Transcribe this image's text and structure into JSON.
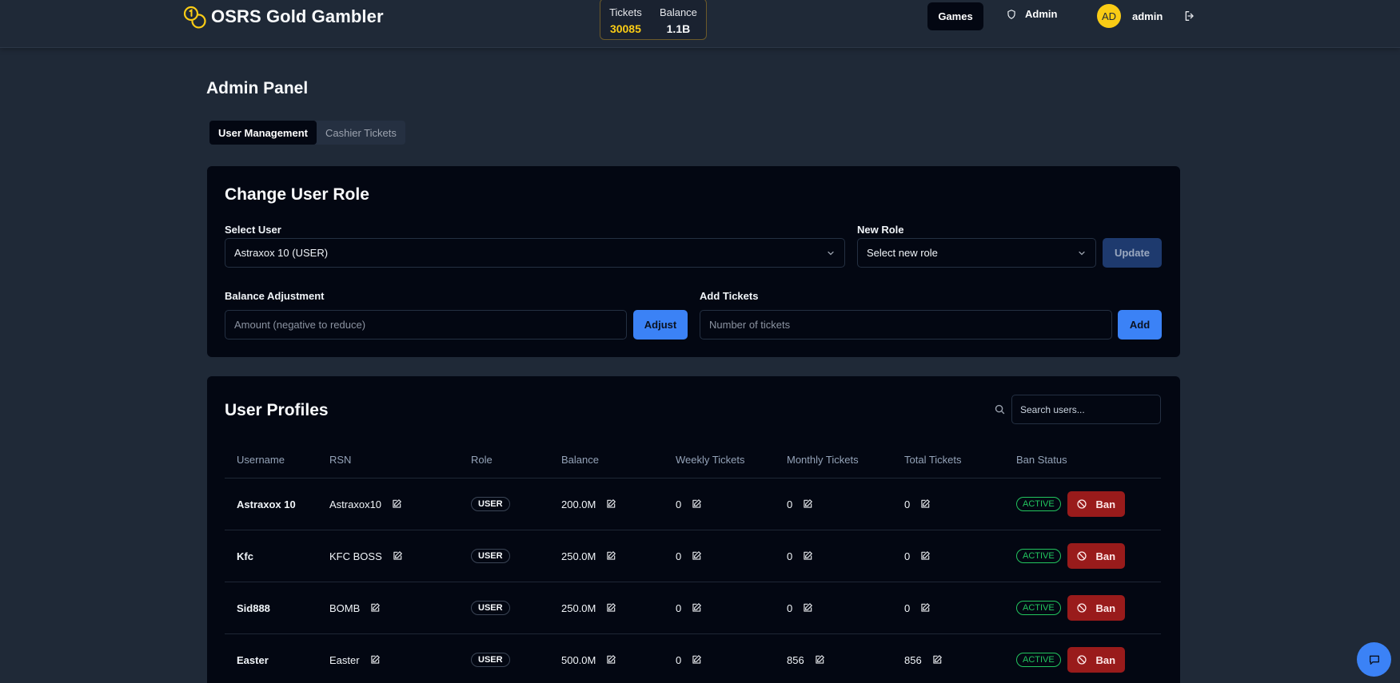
{
  "header": {
    "brand": "OSRS Gold Gambler",
    "tickets_label": "Tickets",
    "tickets_value": "30085",
    "balance_label": "Balance",
    "balance_value": "1.1B",
    "nav_games": "Games",
    "nav_admin": "Admin",
    "avatar_initials": "AD",
    "username": "admin"
  },
  "page": {
    "title": "Admin Panel",
    "tabs": [
      {
        "label": "User Management",
        "active": true
      },
      {
        "label": "Cashier Tickets",
        "active": false
      }
    ]
  },
  "role_card": {
    "title": "Change User Role",
    "select_user_label": "Select User",
    "select_user_value": "Astraxox 10 (USER)",
    "new_role_label": "New Role",
    "new_role_value": "Select new role",
    "update_button": "Update",
    "balance_label": "Balance Adjustment",
    "balance_placeholder": "Amount (negative to reduce)",
    "adjust_button": "Adjust",
    "tickets_label": "Add Tickets",
    "tickets_placeholder": "Number of tickets",
    "add_button": "Add"
  },
  "profiles": {
    "title": "User Profiles",
    "search_placeholder": "Search users...",
    "columns": [
      "Username",
      "RSN",
      "Role",
      "Balance",
      "Weekly Tickets",
      "Monthly Tickets",
      "Total Tickets",
      "Ban Status"
    ],
    "rows": [
      {
        "username": "Astraxox 10",
        "rsn": "Astraxox10",
        "role": "USER",
        "balance": "200.0M",
        "weekly": "0",
        "monthly": "0",
        "total": "0",
        "status": "ACTIVE",
        "ban": "Ban"
      },
      {
        "username": "Kfc",
        "rsn": "KFC BOSS",
        "role": "USER",
        "balance": "250.0M",
        "weekly": "0",
        "monthly": "0",
        "total": "0",
        "status": "ACTIVE",
        "ban": "Ban"
      },
      {
        "username": "Sid888",
        "rsn": "BOMB",
        "role": "USER",
        "balance": "250.0M",
        "weekly": "0",
        "monthly": "0",
        "total": "0",
        "status": "ACTIVE",
        "ban": "Ban"
      },
      {
        "username": "Easter",
        "rsn": "Easter",
        "role": "USER",
        "balance": "500.0M",
        "weekly": "0",
        "monthly": "856",
        "total": "856",
        "status": "ACTIVE",
        "ban": "Ban"
      }
    ]
  },
  "colors": {
    "background": "#1f2937",
    "card": "#030712",
    "accent_blue": "#3b82f6",
    "gold": "#facc15",
    "ban_red": "#991b1b",
    "active_green": "#22c55e"
  },
  "icons": [
    "coins-icon",
    "shield-icon",
    "logout-icon",
    "chevron-down-icon",
    "search-icon",
    "edit-icon",
    "ban-icon",
    "chat-icon"
  ]
}
